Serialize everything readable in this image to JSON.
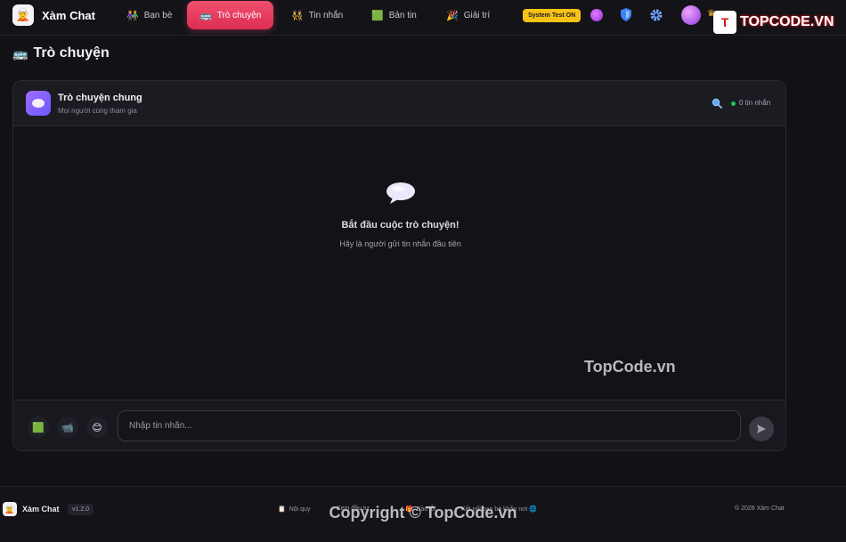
{
  "app": {
    "name": "Xàm Chat",
    "logo_emoji": "🧝"
  },
  "nav": {
    "items": [
      {
        "label": "Bạn bè",
        "icon": "👫"
      },
      {
        "label": "Trò chuyện",
        "icon": "🚌",
        "active": true
      },
      {
        "label": "Tin nhắn",
        "icon": "👯"
      },
      {
        "label": "Bản tin",
        "icon": "🟩"
      },
      {
        "label": "Giải trí",
        "icon": "🎉"
      }
    ],
    "system_badge": "System Test ON"
  },
  "page": {
    "title": "Trò chuyện",
    "title_icon": "🚌"
  },
  "room": {
    "title": "Trò chuyện chung",
    "subtitle": "Mọi người cùng tham gia",
    "message_count": "0 tin nhắn"
  },
  "empty_state": {
    "title": "Bắt đầu cuộc trò chuyện!",
    "subtitle": "Hãy là người gửi tin nhắn đầu tiên"
  },
  "composer": {
    "placeholder": "Nhập tin nhắn...",
    "tools": [
      {
        "name": "image",
        "icon": "🟩"
      },
      {
        "name": "gif",
        "icon": "📹"
      },
      {
        "name": "emoji",
        "icon": "😊"
      }
    ]
  },
  "footer": {
    "brand": "Xàm Chat",
    "version": "v1.2.0",
    "links": [
      {
        "icon": "📋",
        "label": "Nội quy"
      },
      {
        "icon": "",
        "label": "Xem đầu tư"
      },
      {
        "icon": "🎁",
        "label": "Báo lỗi"
      },
      {
        "icon": "",
        "label": "Kết nối bạn bè khắp nơi 🌐"
      }
    ],
    "copyright": "© 2026 Xàm Chat"
  },
  "watermarks": {
    "mid": "TopCode.vn",
    "bottom": "Copyright © TopCode.vn",
    "corner_text": "TOPCODE.VN",
    "corner_mark": "T"
  },
  "colors": {
    "accent": "#e8395d",
    "badge": "#f6c216",
    "online": "#22c55e",
    "background": "#111116"
  }
}
